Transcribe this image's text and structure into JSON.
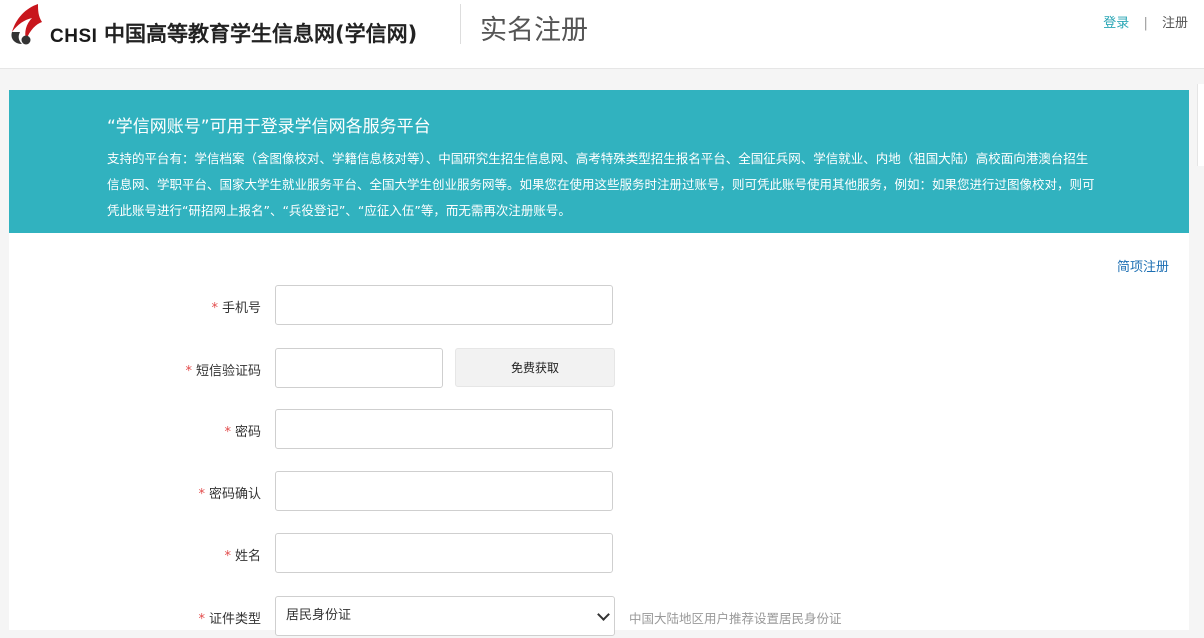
{
  "header": {
    "logo_text": "CHSI",
    "site_name": "中国高等教育学生信息网(学信网)",
    "page_heading": "实名注册",
    "links": {
      "login": "登录",
      "separator": "|",
      "register": "注册"
    }
  },
  "banner": {
    "title": "“学信网账号”可用于登录学信网各服务平台",
    "description": "支持的平台有：学信档案（含图像校对、学籍信息核对等）、中国研究生招生信息网、高考特殊类型招生报名平台、全国征兵网、学信就业、内地（祖国大陆）高校面向港澳台招生信息网、学职平台、国家大学生就业服务平台、全国大学生创业服务网等。如果您在使用这些服务时注册过账号，则可凭此账号使用其他服务，例如：如果您进行过图像校对，则可凭此账号进行“研招网上报名”、“兵役登记”、“应征入伍”等，而无需再次注册账号。"
  },
  "simple_register_link": "简项注册",
  "form": {
    "required_mark": "*",
    "phone": {
      "label": "手机号",
      "value": ""
    },
    "sms_code": {
      "label": "短信验证码",
      "value": "",
      "button": "免费获取"
    },
    "password": {
      "label": "密码",
      "value": ""
    },
    "password_confirm": {
      "label": "密码确认",
      "value": ""
    },
    "name": {
      "label": "姓名",
      "value": ""
    },
    "id_type": {
      "label": "证件类型",
      "selected": "居民身份证",
      "hint": "中国大陆地区用户推荐设置居民身份证"
    }
  },
  "colors": {
    "banner_bg": "#31b2bf",
    "logo_red": "#c8161d",
    "link_teal": "#2aa6b5",
    "link_blue": "#1d6fb3",
    "required_red": "#e24a4a"
  }
}
